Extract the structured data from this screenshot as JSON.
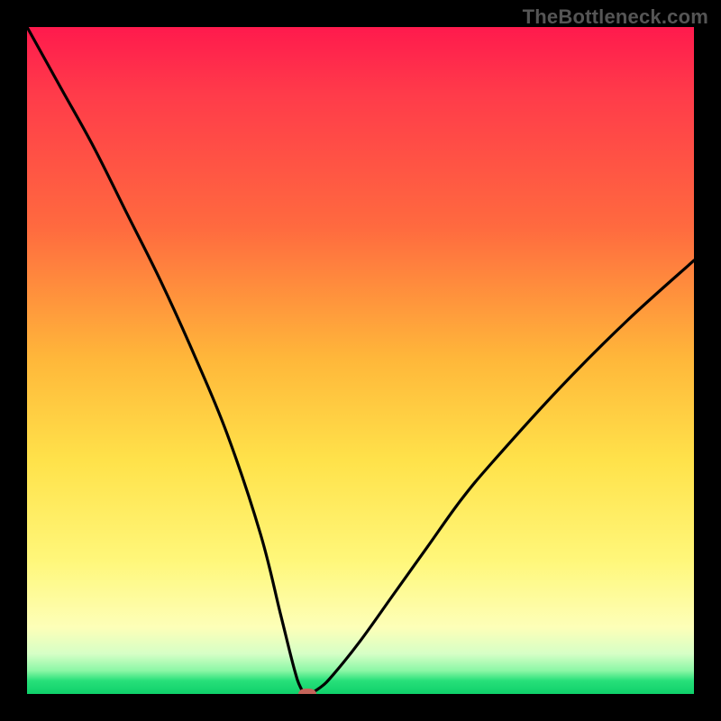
{
  "watermark": "TheBottleneck.com",
  "chart_data": {
    "type": "line",
    "title": "",
    "xlabel": "",
    "ylabel": "",
    "xlim": [
      0,
      100
    ],
    "ylim": [
      0,
      100
    ],
    "grid": false,
    "legend": false,
    "annotations": [],
    "series": [
      {
        "name": "bottleneck-curve",
        "x": [
          0,
          5,
          10,
          15,
          20,
          25,
          30,
          35,
          38,
          40,
          41,
          42,
          44,
          46,
          50,
          55,
          60,
          65,
          70,
          80,
          90,
          100
        ],
        "values": [
          100,
          91,
          82,
          72,
          62,
          51,
          39,
          24,
          12,
          4,
          1,
          0,
          1,
          3,
          8,
          15,
          22,
          29,
          35,
          46,
          56,
          65
        ]
      }
    ],
    "marker": {
      "x": 42,
      "y": 0
    },
    "gradient_stops": [
      {
        "pct": 0,
        "color": "#ff1a4d"
      },
      {
        "pct": 50,
        "color": "#ffb83a"
      },
      {
        "pct": 80,
        "color": "#fff77a"
      },
      {
        "pct": 96,
        "color": "#8cf7a6"
      },
      {
        "pct": 100,
        "color": "#0fd06a"
      }
    ]
  }
}
